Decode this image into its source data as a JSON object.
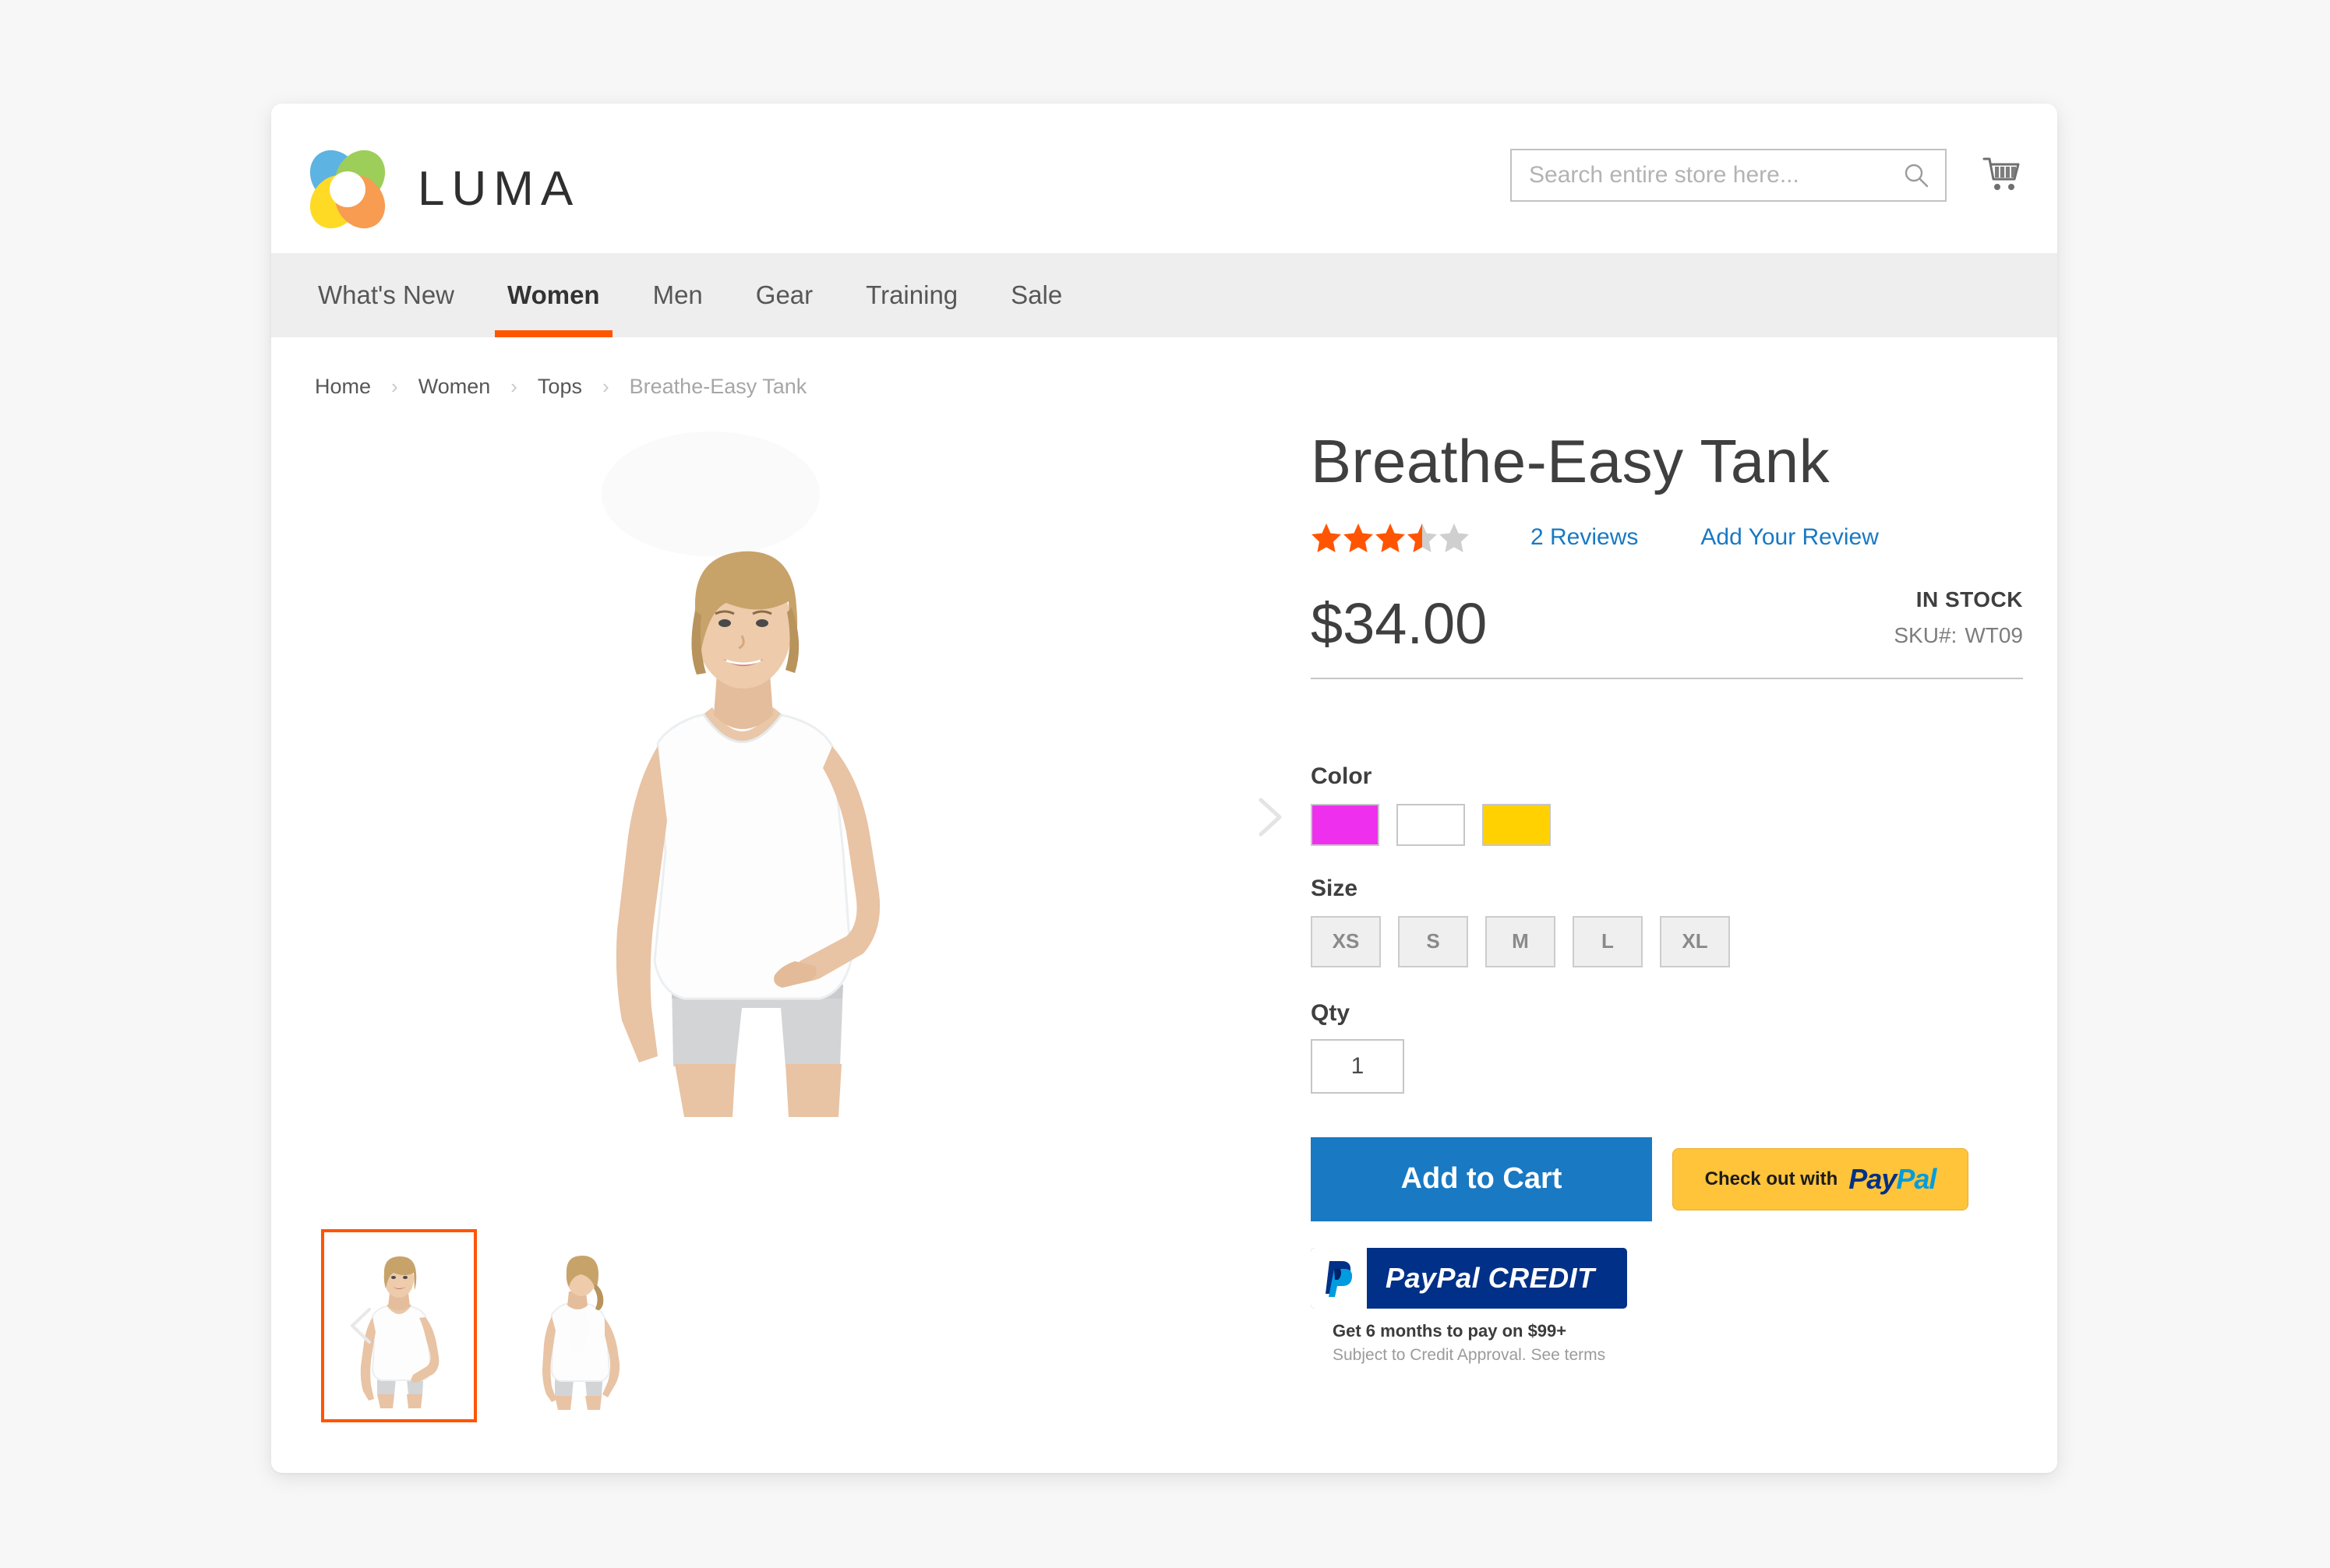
{
  "brand": {
    "name": "LUMA",
    "logo_colors": [
      "#41a6dd",
      "#8cc63e",
      "#ffd400",
      "#f68b33"
    ]
  },
  "search": {
    "placeholder": "Search entire store here...",
    "value": ""
  },
  "header": {
    "cart_icon": "shopping-cart-icon",
    "search_icon": "search-icon"
  },
  "nav": {
    "items": [
      {
        "label": "What's New",
        "active": false
      },
      {
        "label": "Women",
        "active": true
      },
      {
        "label": "Men",
        "active": false
      },
      {
        "label": "Gear",
        "active": false
      },
      {
        "label": "Training",
        "active": false
      },
      {
        "label": "Sale",
        "active": false
      }
    ],
    "active_color": "#ff5501"
  },
  "breadcrumb": {
    "items": [
      "Home",
      "Women",
      "Tops",
      "Breathe-Easy Tank"
    ],
    "separator": "›"
  },
  "product": {
    "title": "Breathe-Easy Tank",
    "rating_stars": 3.5,
    "rating_max": 5,
    "reviews_link": "2 Reviews",
    "add_review_link": "Add Your Review",
    "price": "$34.00",
    "stock_status": "IN STOCK",
    "sku_label": "SKU#:",
    "sku_value": "WT09",
    "star_color": "#ff5501",
    "link_color": "#1979c3"
  },
  "options": {
    "color_label": "Color",
    "colors": [
      {
        "name": "purple",
        "hex": "#ee30ee"
      },
      {
        "name": "white",
        "hex": "#ffffff"
      },
      {
        "name": "yellow",
        "hex": "#ffd100"
      }
    ],
    "size_label": "Size",
    "sizes": [
      "XS",
      "S",
      "M",
      "L",
      "XL"
    ],
    "qty_label": "Qty",
    "qty_value": "1"
  },
  "actions": {
    "add_to_cart": "Add to Cart",
    "paypal_checkout_prefix": "Check out with",
    "paypal_word_pay": "Pay",
    "paypal_word_pal": "Pal",
    "paypal_credit_text": "PayPal CREDIT",
    "paypal_credit_word1": "PayPal ",
    "paypal_credit_word2": "CREDIT",
    "credit_line_1": "Get 6 months to pay on $99+",
    "credit_line_2": "Subject to Credit Approval. See terms",
    "cart_button_color": "#1979c3",
    "paypal_button_color": "#ffc439",
    "paypal_credit_color": "#003087"
  },
  "gallery": {
    "prev_arrow": "chevron-left-icon",
    "next_arrow": "chevron-right-icon",
    "thumbnails": [
      {
        "alt": "Breathe-Easy Tank front view",
        "selected": true
      },
      {
        "alt": "Breathe-Easy Tank back view",
        "selected": false
      }
    ],
    "main_image_alt": "Breathe-Easy Tank front view",
    "selected_border_color": "#ff5501"
  }
}
